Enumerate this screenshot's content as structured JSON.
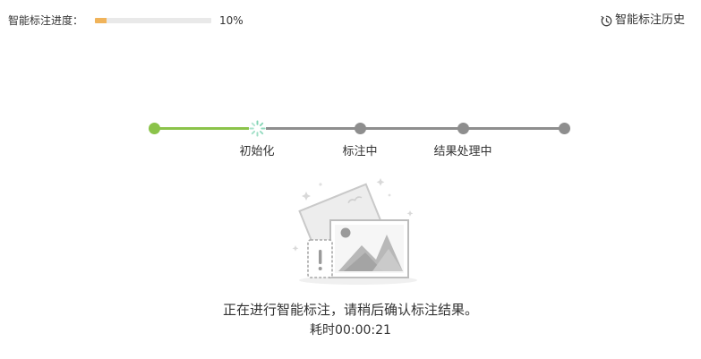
{
  "header": {
    "progress_label": "智能标注进度：",
    "progress_value": 0.1,
    "progress_text": "10%",
    "progress_color": "#f0b35a",
    "history_icon": "history-clock-icon",
    "history_label": "智能标注历史"
  },
  "stepper": {
    "done_color": "#8bc34a",
    "todo_color": "#8e8e8e",
    "steps": [
      {
        "label": "",
        "state": "done"
      },
      {
        "label": "初始化",
        "state": "active"
      },
      {
        "label": "标注中",
        "state": "todo"
      },
      {
        "label": "结果处理中",
        "state": "todo"
      },
      {
        "label": "",
        "state": "todo"
      }
    ]
  },
  "status": {
    "illustration_icon": "image-placeholder-warning-icon",
    "message": "正在进行智能标注，请稍后确认标注结果。",
    "elapsed_label": "耗时",
    "elapsed_value": "00:00:21"
  }
}
